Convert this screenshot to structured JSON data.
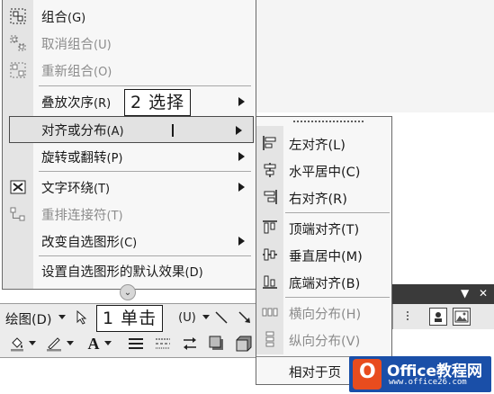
{
  "main_menu": {
    "items": [
      {
        "label": "组合",
        "key": "(G)",
        "icon": "group-icon",
        "disabled": false
      },
      {
        "label": "取消组合",
        "key": "(U)",
        "icon": "ungroup-icon",
        "disabled": true
      },
      {
        "label": "重新组合",
        "key": "(O)",
        "icon": "regroup-icon",
        "disabled": true
      },
      {
        "label": "叠放次序",
        "key": "(R)",
        "submenu": true,
        "disabled": false
      },
      {
        "label": "对齐或分布",
        "key": "(A)",
        "submenu": true,
        "highlighted": true
      },
      {
        "label": "旋转或翻转",
        "key": "(P)",
        "submenu": true,
        "disabled": false
      },
      {
        "label": "文字环绕",
        "key": "(T)",
        "icon": "text-wrap-icon",
        "submenu": true,
        "disabled": false
      },
      {
        "label": "重排连接符",
        "key": "(T)",
        "icon": "reroute-connector-icon",
        "disabled": true
      },
      {
        "label": "改变自选图形",
        "key": "(C)",
        "submenu": true,
        "disabled": false
      },
      {
        "label": "设置自选图形的默认效果",
        "key": "(D)",
        "disabled": false
      }
    ]
  },
  "sub_menu": {
    "items": [
      {
        "label": "左对齐",
        "key": "(L)",
        "icon": "align-left-icon",
        "disabled": false
      },
      {
        "label": "水平居中",
        "key": "(C)",
        "icon": "align-center-icon",
        "disabled": false
      },
      {
        "label": "右对齐",
        "key": "(R)",
        "icon": "align-right-icon",
        "disabled": false
      },
      {
        "label": "顶端对齐",
        "key": "(T)",
        "icon": "align-top-icon",
        "disabled": false
      },
      {
        "label": "垂直居中",
        "key": "(M)",
        "icon": "align-middle-icon",
        "disabled": false
      },
      {
        "label": "底端对齐",
        "key": "(B)",
        "icon": "align-bottom-icon",
        "disabled": false
      },
      {
        "label": "横向分布",
        "key": "(H)",
        "icon": "distribute-horizontal-icon",
        "disabled": true
      },
      {
        "label": "纵向分布",
        "key": "(V)",
        "icon": "distribute-vertical-icon",
        "disabled": true
      }
    ],
    "bottom_label": "相对于页"
  },
  "toolbar": {
    "draw_label": "绘图(D)",
    "mid_key": "(U)"
  },
  "callouts": {
    "step2": "2 选择",
    "step1": "1 单击"
  },
  "watermark": {
    "title": "Office教程网",
    "subtitle": "www.office26.com"
  }
}
